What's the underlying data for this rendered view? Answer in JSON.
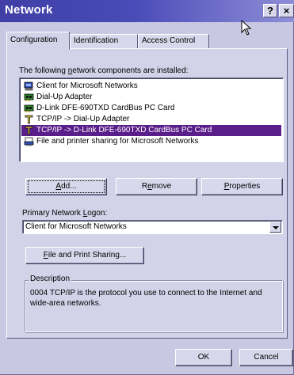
{
  "window": {
    "title": "Network",
    "help_label": "?",
    "close_label": "×"
  },
  "tabs": [
    {
      "label": "Configuration",
      "active": true
    },
    {
      "label": "Identification",
      "active": false
    },
    {
      "label": "Access Control",
      "active": false
    }
  ],
  "components": {
    "label_pre": "The following ",
    "label_underlined": "n",
    "label_post": "etwork components are installed:",
    "items": [
      {
        "label": "Client for Microsoft Networks",
        "icon": "client-network-icon",
        "selected": false
      },
      {
        "label": "Dial-Up Adapter",
        "icon": "adapter-icon",
        "selected": false
      },
      {
        "label": "D-Link DFE-690TXD CardBus PC Card",
        "icon": "adapter-icon",
        "selected": false
      },
      {
        "label": "TCP/IP -> Dial-Up Adapter",
        "icon": "protocol-icon",
        "selected": false
      },
      {
        "label": "TCP/IP -> D-Link DFE-690TXD CardBus PC Card",
        "icon": "protocol-icon",
        "selected": true
      },
      {
        "label": "File and printer sharing for Microsoft Networks",
        "icon": "file-sharing-icon",
        "selected": false
      }
    ]
  },
  "buttons": {
    "add_underlined": "A",
    "add_rest": "dd...",
    "remove_pre": "R",
    "remove_underlined": "e",
    "remove_rest": "move",
    "properties_underlined": "P",
    "properties_rest": "roperties",
    "file_print_underlined": "F",
    "file_print_rest": "ile and Print Sharing...",
    "ok_label": "OK",
    "cancel_label": "Cancel"
  },
  "logon": {
    "label_pre": "Primary Network ",
    "label_underlined": "L",
    "label_post": "ogon:",
    "selected_value": "Client for Microsoft Networks"
  },
  "description": {
    "legend": "Description",
    "text": "0004 TCP/IP is the protocol you use to connect to the Internet and wide-area networks."
  },
  "colors": {
    "titlebar": "#3f3fa6",
    "selection": "#5a1e8a",
    "window_background": "#c8c8e2"
  }
}
